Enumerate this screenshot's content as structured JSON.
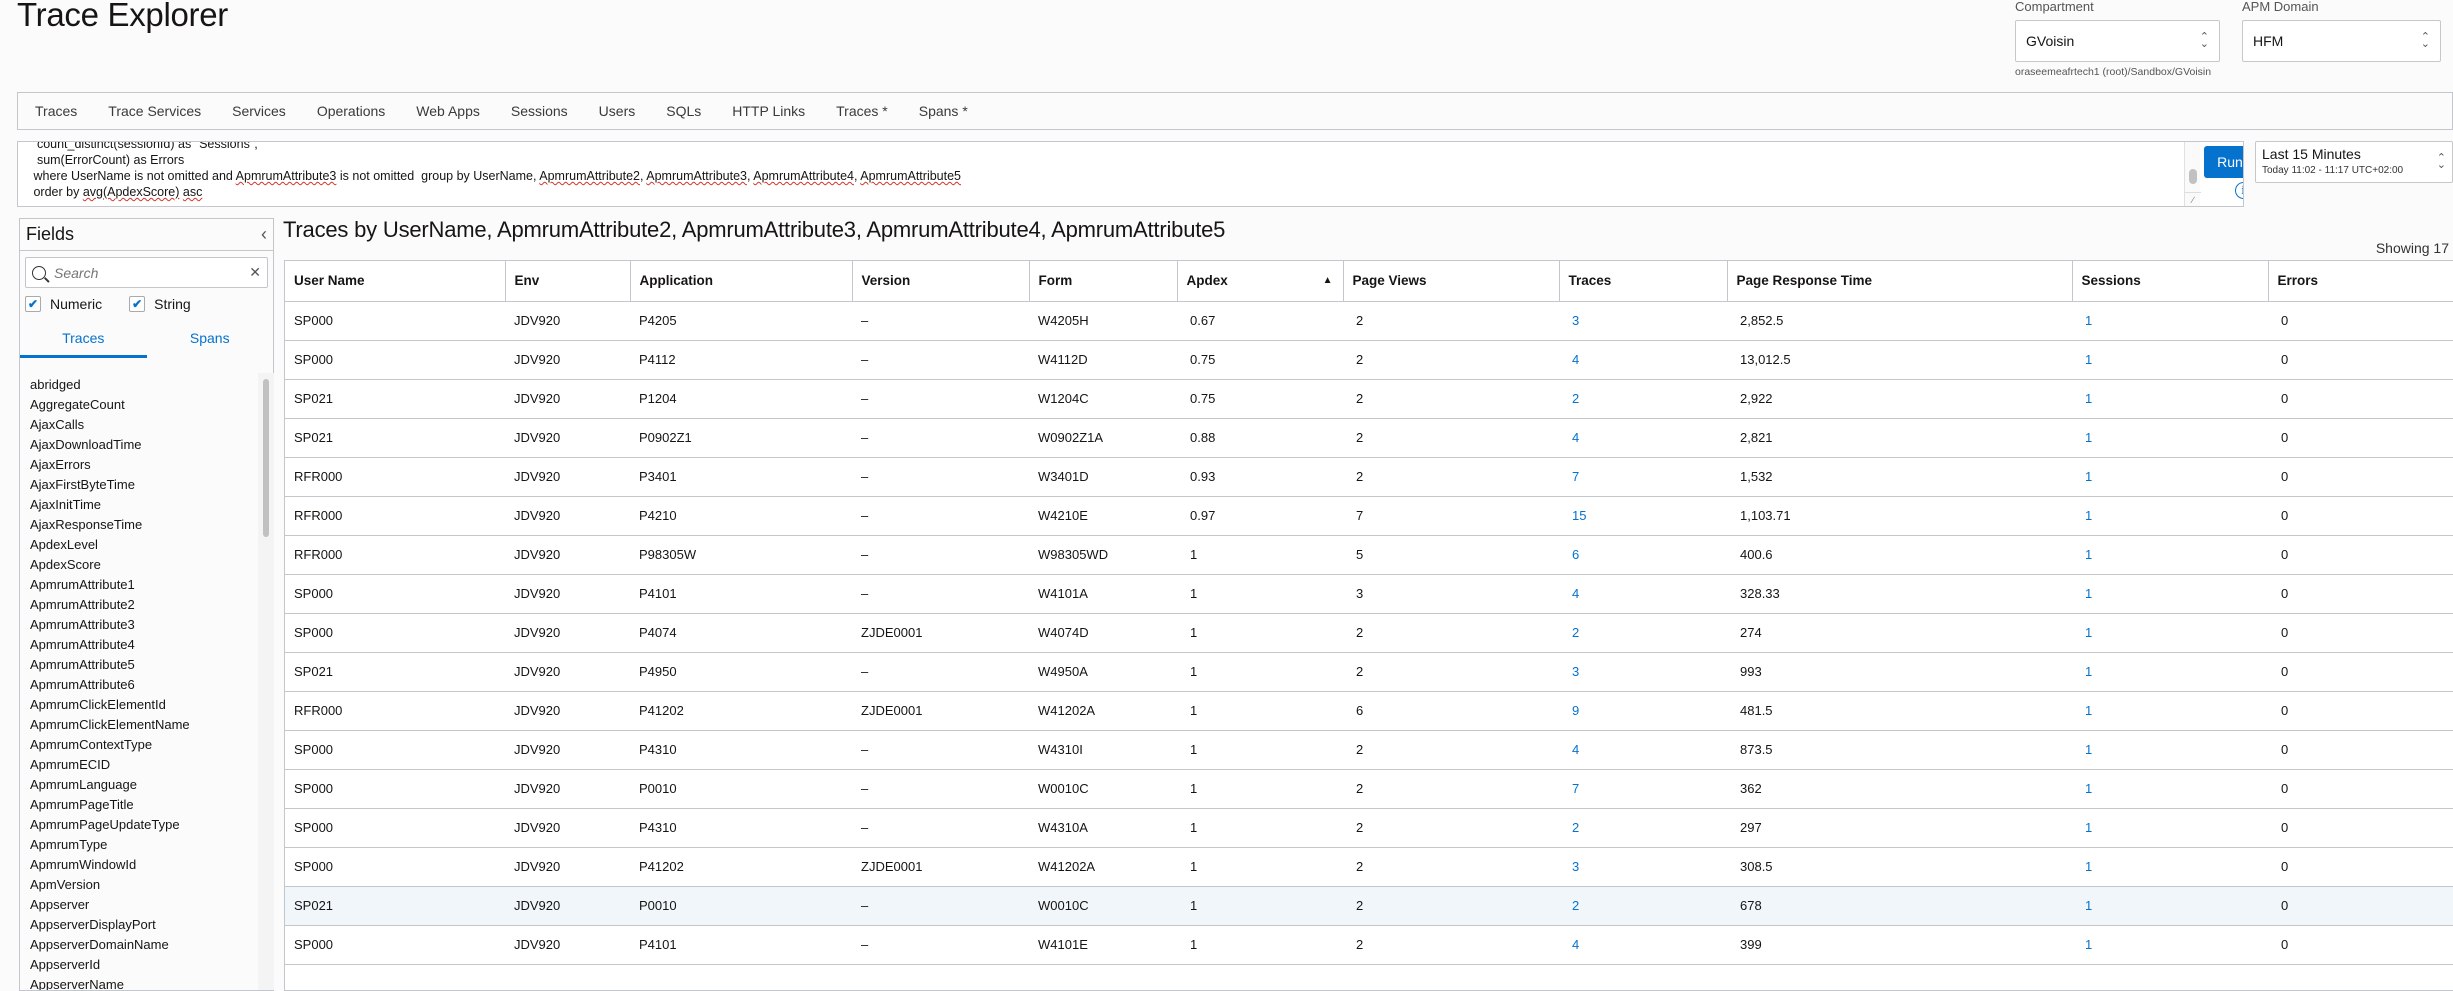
{
  "header": {
    "title": "Trace Explorer",
    "compartment": {
      "label": "Compartment",
      "value": "GVoisin",
      "path": "oraseemeafrtech1 (root)/Sandbox/GVoisin"
    },
    "apm_domain": {
      "label": "APM Domain",
      "value": "HFM"
    }
  },
  "tabs": [
    "Traces",
    "Trace Services",
    "Services",
    "Operations",
    "Web Apps",
    "Sessions",
    "Users",
    "SQLs",
    "HTTP Links",
    "Traces *",
    "Spans *"
  ],
  "query": {
    "line1": "  count_distinct(sessionId) as \"Sessions\",",
    "line2": "  sum(ErrorCount) as Errors",
    "line3_pre": " where UserName is not omitted and ",
    "line3_attr3": "ApmrumAttribute3",
    "line3_mid": " is not omitted  group by UserName, ",
    "line3_a2": "ApmrumAttribute2",
    "line3_a3": "ApmrumAttribute3",
    "line3_a4": "ApmrumAttribute4",
    "line3_a5": "ApmrumAttribute5",
    "line4_pre": " order by ",
    "line4_fn": "avg(ApdexScore)",
    "line4_asc": "asc",
    "sep": ", ",
    "space": " ",
    "run_label": "Run",
    "info_glyph": "i"
  },
  "time_range": {
    "label": "Last 15 Minutes",
    "detail": "Today 11:02 - 11:17 UTC+02:00"
  },
  "fields_panel": {
    "title": "Fields",
    "search_placeholder": "Search",
    "filters": [
      {
        "label": "Numeric",
        "checked": true
      },
      {
        "label": "String",
        "checked": true
      }
    ],
    "tabs": [
      "Traces",
      "Spans"
    ],
    "active_tab": "Traces",
    "items": [
      "abridged",
      "AggregateCount",
      "AjaxCalls",
      "AjaxDownloadTime",
      "AjaxErrors",
      "AjaxFirstByteTime",
      "AjaxInitTime",
      "AjaxResponseTime",
      "ApdexLevel",
      "ApdexScore",
      "ApmrumAttribute1",
      "ApmrumAttribute2",
      "ApmrumAttribute3",
      "ApmrumAttribute4",
      "ApmrumAttribute5",
      "ApmrumAttribute6",
      "ApmrumClickElementId",
      "ApmrumClickElementName",
      "ApmrumContextType",
      "ApmrumECID",
      "ApmrumLanguage",
      "ApmrumPageTitle",
      "ApmrumPageUpdateType",
      "ApmrumType",
      "ApmrumWindowId",
      "ApmVersion",
      "Appserver",
      "AppserverDisplayPort",
      "AppserverDomainName",
      "AppserverId",
      "AppserverName"
    ]
  },
  "results": {
    "title": "Traces by UserName, ApmrumAttribute2, ApmrumAttribute3, ApmrumAttribute4, ApmrumAttribute5",
    "showing": "Showing 17",
    "sort_indicator": "▲",
    "columns": [
      "User Name",
      "Env",
      "Application",
      "Version",
      "Form",
      "Apdex",
      "Page Views",
      "Traces",
      "Page Response Time",
      "Sessions",
      "Errors"
    ],
    "rows": [
      [
        "SP000",
        "JDV920",
        "P4205",
        "–",
        "W4205H",
        "0.67",
        "2",
        "3",
        "2,852.5",
        "1",
        "0"
      ],
      [
        "SP000",
        "JDV920",
        "P4112",
        "–",
        "W4112D",
        "0.75",
        "2",
        "4",
        "13,012.5",
        "1",
        "0"
      ],
      [
        "SP021",
        "JDV920",
        "P1204",
        "–",
        "W1204C",
        "0.75",
        "2",
        "2",
        "2,922",
        "1",
        "0"
      ],
      [
        "SP021",
        "JDV920",
        "P0902Z1",
        "–",
        "W0902Z1A",
        "0.88",
        "2",
        "4",
        "2,821",
        "1",
        "0"
      ],
      [
        "RFR000",
        "JDV920",
        "P3401",
        "–",
        "W3401D",
        "0.93",
        "2",
        "7",
        "1,532",
        "1",
        "0"
      ],
      [
        "RFR000",
        "JDV920",
        "P4210",
        "–",
        "W4210E",
        "0.97",
        "7",
        "15",
        "1,103.71",
        "1",
        "0"
      ],
      [
        "RFR000",
        "JDV920",
        "P98305W",
        "–",
        "W98305WD",
        "1",
        "5",
        "6",
        "400.6",
        "1",
        "0"
      ],
      [
        "SP000",
        "JDV920",
        "P4101",
        "–",
        "W4101A",
        "1",
        "3",
        "4",
        "328.33",
        "1",
        "0"
      ],
      [
        "SP000",
        "JDV920",
        "P4074",
        "ZJDE0001",
        "W4074D",
        "1",
        "2",
        "2",
        "274",
        "1",
        "0"
      ],
      [
        "SP021",
        "JDV920",
        "P4950",
        "–",
        "W4950A",
        "1",
        "2",
        "3",
        "993",
        "1",
        "0"
      ],
      [
        "RFR000",
        "JDV920",
        "P41202",
        "ZJDE0001",
        "W41202A",
        "1",
        "6",
        "9",
        "481.5",
        "1",
        "0"
      ],
      [
        "SP000",
        "JDV920",
        "P4310",
        "–",
        "W4310I",
        "1",
        "2",
        "4",
        "873.5",
        "1",
        "0"
      ],
      [
        "SP000",
        "JDV920",
        "P0010",
        "–",
        "W0010C",
        "1",
        "2",
        "7",
        "362",
        "1",
        "0"
      ],
      [
        "SP000",
        "JDV920",
        "P4310",
        "–",
        "W4310A",
        "1",
        "2",
        "2",
        "297",
        "1",
        "0"
      ],
      [
        "SP000",
        "JDV920",
        "P41202",
        "ZJDE0001",
        "W41202A",
        "1",
        "2",
        "3",
        "308.5",
        "1",
        "0"
      ],
      [
        "SP021",
        "JDV920",
        "P0010",
        "–",
        "W0010C",
        "1",
        "2",
        "2",
        "678",
        "1",
        "0"
      ],
      [
        "SP000",
        "JDV920",
        "P4101",
        "–",
        "W4101E",
        "1",
        "2",
        "4",
        "399",
        "1",
        "0"
      ]
    ],
    "selected_row": 15
  },
  "colors": {
    "accent": "#0572ce",
    "selected_row": "#f1f6fa",
    "border": "#c3c6ca"
  }
}
